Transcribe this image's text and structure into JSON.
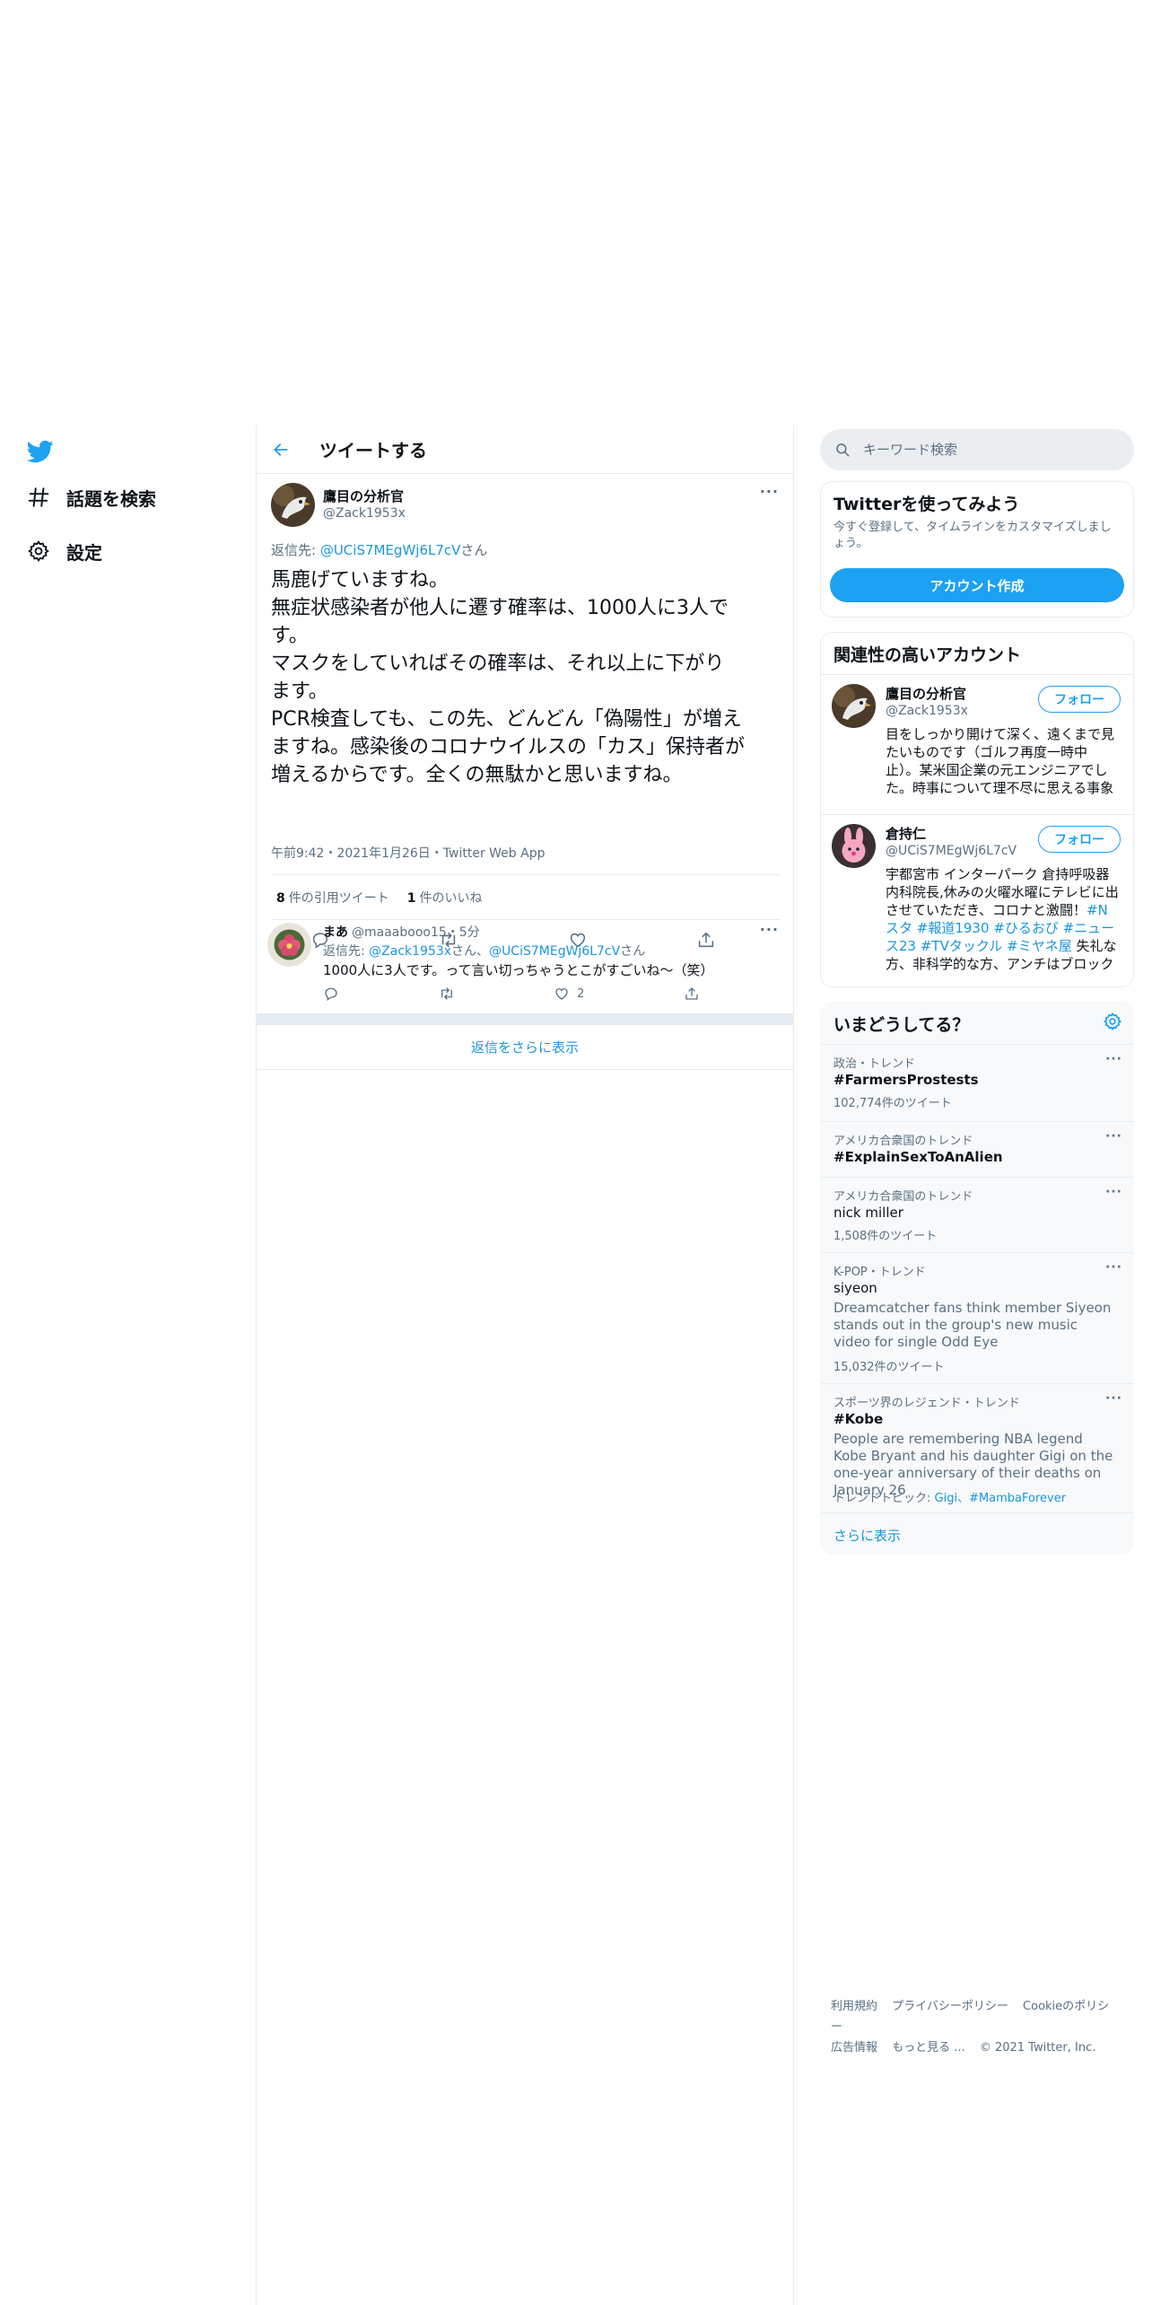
{
  "nav": {
    "logo_icon": "twitter-bird-icon",
    "items": [
      {
        "label": "話題を検索",
        "icon": "hashtag-icon"
      },
      {
        "label": "設定",
        "icon": "gear-icon"
      }
    ]
  },
  "header": {
    "title": "ツイートする"
  },
  "main_tweet": {
    "name": "鷹目の分析官",
    "handle": "@Zack1953x",
    "reply_prefix": "返信先: ",
    "reply_to": "@UCiS7MEgWj6L7cV",
    "reply_suffix": "さん",
    "text": "馬鹿げていますね。\n無症状感染者が他人に遷す確率は、1000人に3人で\nす。\nマスクをしていればその確率は、それ以上に下がり\nます。\nPCR検査しても、この先、どんどん「偽陽性」が増え\nますね。感染後のコロナウイルスの「カス」保持者が\n増えるからです。全くの無駄かと思いますね。",
    "meta": "午前9:42・2021年1月26日・Twitter Web App",
    "quote_count": "8",
    "quote_label": "件の引用ツイート",
    "like_count": "1",
    "like_label": "件のいいね"
  },
  "reply": {
    "name": "まあ",
    "handle": "@maaabooo15",
    "time": "・5分",
    "reply_prefix": "返信先: ",
    "reply_to_1": "@Zack1953x",
    "reply_mid": "さん、",
    "reply_to_2": "@UCiS7MEgWj6L7cV",
    "reply_suffix": "さん",
    "text": "1000人に3人です。って言い切っちゃうとこがすごいね〜（笑）",
    "like_count": "2"
  },
  "show_more_replies": "返信をさらに表示",
  "search": {
    "placeholder": "キーワード検索"
  },
  "signup": {
    "title": "Twitterを使ってみよう",
    "description": "今すぐ登録して、タイムラインをカスタマイズしましょう。",
    "button": "アカウント作成"
  },
  "related": {
    "title": "関連性の高いアカウント",
    "follow_label": "フォロー",
    "accounts": [
      {
        "name": "鷹目の分析官",
        "handle": "@Zack1953x",
        "bio": "目をしっかり開けて深く、遠くまで見たいものです（ゴルフ再度一時中止）。某米国企業の元エンジニアでした。時事について理不尽に思える事象は、暴言付でツイートします^^;"
      },
      {
        "name": "倉持仁",
        "handle": "@UCiS7MEgWj6L7cV",
        "bio_plain": "宇都宮市 インターパーク 倉持呼吸器内科院長,休みの火曜水曜にテレビに出させていただき、コロナと激闘！",
        "bio_tags": "#Nスタ #報道1930 #ひるおび #ニュース23 #TVタックル #ミヤネ屋",
        "bio_tail": " 失礼な方、非科学的な方、アンチはブロック"
      }
    ]
  },
  "trends": {
    "title": "いまどうしてる？",
    "settings_icon": "gear-icon",
    "items": [
      {
        "context": "政治・トレンド",
        "name": "#FarmersProstests",
        "count": "102,774件のツイート"
      },
      {
        "context": "アメリカ合衆国のトレンド",
        "name": "#ExplainSexToAnAlien"
      },
      {
        "context": "アメリカ合衆国のトレンド",
        "name": "nick miller",
        "count": "1,508件のツイート"
      },
      {
        "context": "K-POP・トレンド",
        "name": "siyeon",
        "description": "Dreamcatcher fans think member Siyeon stands out in the group's new music video for single Odd Eye",
        "count": "15,032件のツイート"
      },
      {
        "context": "スポーツ界のレジェンド・トレンド",
        "name": "#Kobe",
        "description": "People are remembering NBA legend Kobe Bryant and his daughter Gigi on the one-year anniversary of their deaths on January 26",
        "topic_label": "トレンドトピック: ",
        "topic_links": "Gigi、#MambaForever"
      }
    ],
    "show_more": "さらに表示"
  },
  "footer": {
    "line1": [
      "利用規約",
      "プライバシーポリシー",
      "Cookieのポリシー"
    ],
    "line2": [
      "広告情報",
      "もっと見る ...",
      "© 2021 Twitter, Inc."
    ]
  },
  "colors": {
    "accent": "#1da1f2",
    "link": "#1b95e0",
    "text": "#0f1419",
    "secondary": "#5b7083",
    "border": "#e6ecf0"
  }
}
